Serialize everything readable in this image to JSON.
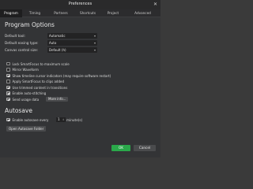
{
  "window": {
    "title": "Preferences",
    "close_glyph": "✕"
  },
  "tabs": [
    {
      "label": "Program",
      "active": true
    },
    {
      "label": "Timing"
    },
    {
      "label": "Portners"
    },
    {
      "label": "Shortcuts"
    },
    {
      "label": "Project"
    },
    {
      "label": "Advanced"
    }
  ],
  "program_options": {
    "heading": "Program Options",
    "default_tool": {
      "label": "Default tool:",
      "value": "Automatic"
    },
    "default_easing": {
      "label": "Default easing type:",
      "value": "Auto"
    },
    "canvas_control": {
      "label": "Canvas control size:",
      "value": "Default (h)"
    }
  },
  "checkboxes": [
    {
      "label": "Lock SmartFocus to maximum scale",
      "checked": false
    },
    {
      "label": "Mirror Waveform",
      "checked": false
    },
    {
      "label": "Show timeline cursor indicators (may require software restart)",
      "checked": true
    },
    {
      "label": "Apply SmartFocus to clips added",
      "checked": false
    },
    {
      "label": "Use trimmed content in transitions",
      "checked": true
    },
    {
      "label": "Enable auto-stitching",
      "checked": true
    },
    {
      "label": "Send usage data",
      "checked": true
    }
  ],
  "more_info_label": "More info...",
  "autosave": {
    "heading": "Autosave",
    "enable_label": "Enable autosave every",
    "enabled": true,
    "interval_value": "1",
    "unit_label": "minute(s)",
    "open_folder_label": "Open Autosave Folder"
  },
  "footer": {
    "ok_label": "OK",
    "cancel_label": "Cancel"
  },
  "colors": {
    "accent_ok": "#2aa84a",
    "background": "#333436"
  }
}
